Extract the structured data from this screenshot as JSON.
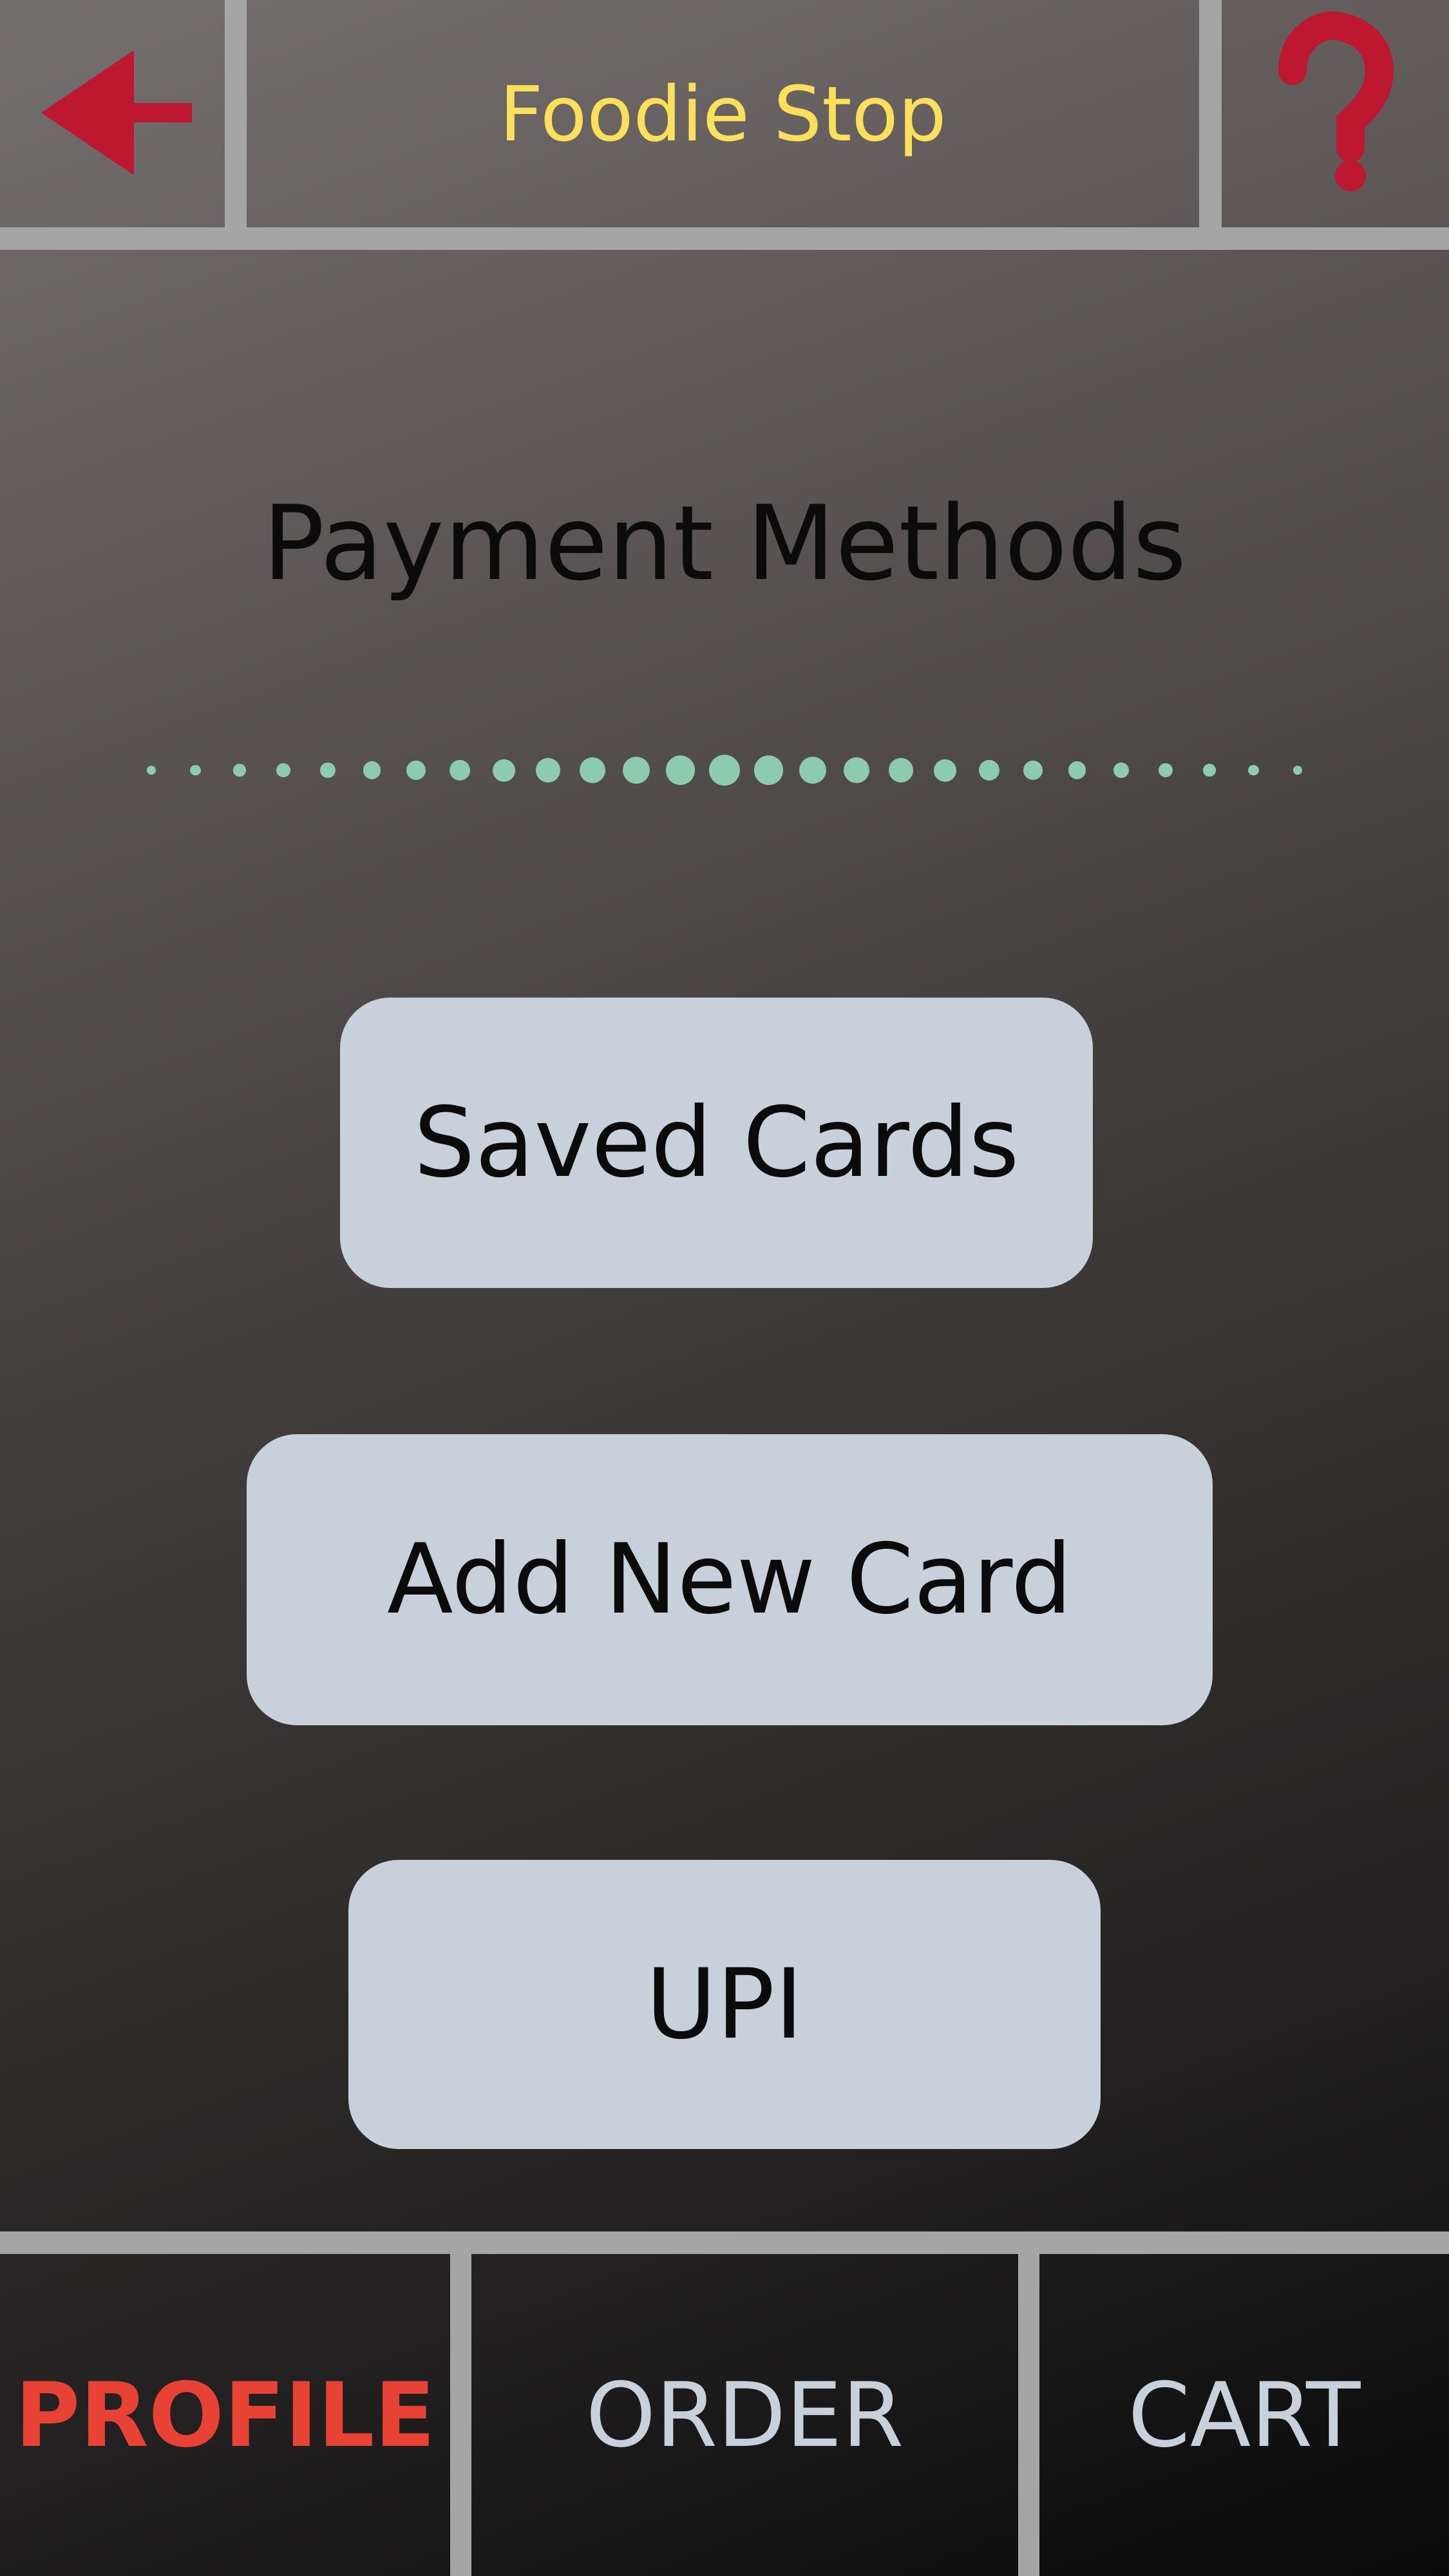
{
  "header": {
    "title": "Foodie Stop",
    "back_icon": "arrow-left-icon",
    "help_icon": "question-mark-icon"
  },
  "main": {
    "title": "Payment Methods",
    "buttons": [
      "Saved Cards",
      "Add New Card",
      "UPI"
    ]
  },
  "bottom_nav": {
    "items": [
      {
        "label": "PROFILE",
        "active": true
      },
      {
        "label": "ORDER",
        "active": false
      },
      {
        "label": "CART",
        "active": false
      }
    ]
  },
  "colors": {
    "accent": "#be1730",
    "title": "#fde05a",
    "active_nav": "#e84235",
    "dots": "#8ccbb0",
    "button": "#c8d0da"
  }
}
